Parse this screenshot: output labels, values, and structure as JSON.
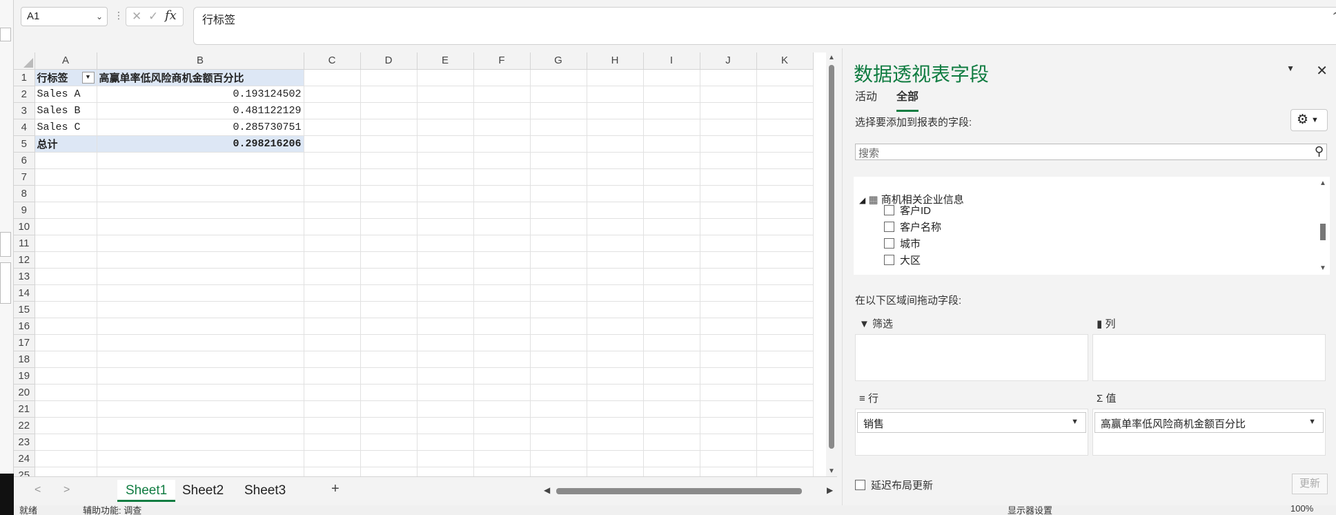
{
  "formula_bar": {
    "name_box": "A1",
    "formula": "行标签",
    "fx_label": "fx"
  },
  "columns": [
    "A",
    "B",
    "C",
    "D",
    "E",
    "F",
    "G",
    "H",
    "I",
    "J",
    "K"
  ],
  "rows": [
    {
      "n": "1",
      "a": "行标签",
      "b": "高赢单率低风险商机金额百分比",
      "style": "hdr"
    },
    {
      "n": "2",
      "a": "Sales A",
      "b": "0.193124502",
      "style": ""
    },
    {
      "n": "3",
      "a": "Sales B",
      "b": "0.481122129",
      "style": ""
    },
    {
      "n": "4",
      "a": "Sales C",
      "b": "0.285730751",
      "style": ""
    },
    {
      "n": "5",
      "a": "总计",
      "b": "0.298216206",
      "style": "tot"
    },
    {
      "n": "6"
    },
    {
      "n": "7"
    },
    {
      "n": "8"
    },
    {
      "n": "9"
    },
    {
      "n": "10"
    },
    {
      "n": "11"
    },
    {
      "n": "12"
    },
    {
      "n": "13"
    },
    {
      "n": "14"
    },
    {
      "n": "15"
    },
    {
      "n": "16"
    },
    {
      "n": "17"
    },
    {
      "n": "18"
    },
    {
      "n": "19"
    },
    {
      "n": "20"
    },
    {
      "n": "21"
    },
    {
      "n": "22"
    },
    {
      "n": "23"
    },
    {
      "n": "24"
    },
    {
      "n": "25"
    }
  ],
  "sheet_tabs": [
    "Sheet1",
    "Sheet2",
    "Sheet3"
  ],
  "active_sheet": "Sheet1",
  "status_bar": {
    "left": "就绪",
    "accessibility": "辅助功能: 调查",
    "display_settings": "显示器设置",
    "zoom": "100%"
  },
  "pivot": {
    "title": "数据透视表字段",
    "tabs": [
      "活动",
      "全部"
    ],
    "active_tab": "全部",
    "choose_label": "选择要添加到报表的字段:",
    "search_placeholder": "搜索",
    "table_name": "商机相关企业信息",
    "fields": [
      "客户ID",
      "客户名称",
      "城市",
      "大区"
    ],
    "drag_label": "在以下区域间拖动字段:",
    "areas": {
      "filter": "筛选",
      "columns": "列",
      "rows": "行",
      "values": "值"
    },
    "rows_field": "销售",
    "values_field": "高赢单率低风险商机金额百分比",
    "defer_label": "延迟布局更新",
    "update_button": "更新"
  }
}
